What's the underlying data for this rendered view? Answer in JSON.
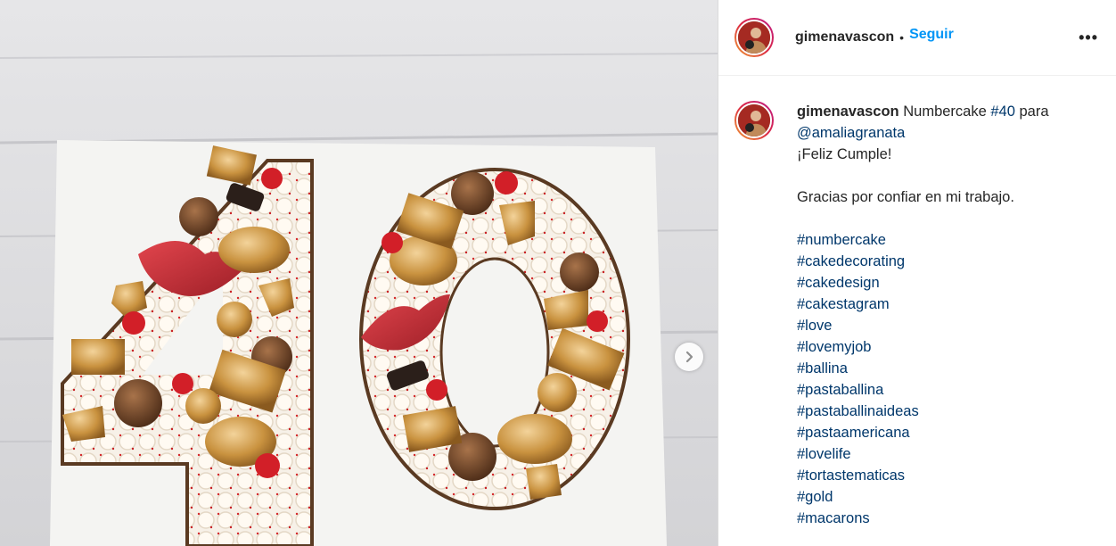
{
  "post": {
    "username": "gimenavascon",
    "separator": "•",
    "follow_label": "Seguir",
    "more_label": "•••"
  },
  "caption": {
    "username": "gimenavascon",
    "intro_text": "Numbercake",
    "intro_hashtag": "#40",
    "intro_para": "para",
    "mention": "@amaliagranata",
    "greeting": "¡Feliz Cumple!",
    "thanks": "Gracias por confiar en mi trabajo.",
    "hashtags": [
      "#numbercake",
      "#cakedecorating",
      "#cakedesign",
      "#cakestagram",
      "#love",
      "#lovemyjob",
      "#ballina",
      "#pastaballina",
      "#pastaballinaideas",
      "#pastaamericana",
      "#lovelife",
      "#tortastematicas",
      "#gold",
      "#macarons"
    ]
  },
  "icons": {
    "next": "chevron-right-icon",
    "more": "more-options-icon"
  }
}
